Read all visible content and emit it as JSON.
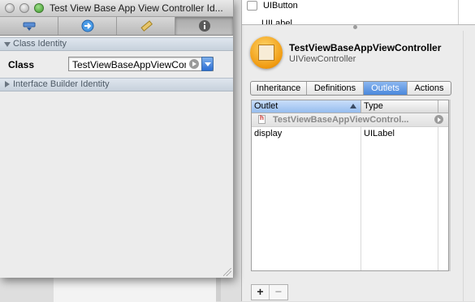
{
  "inspector": {
    "title": "Test View Base App View Controller Id...",
    "tabs": [
      {
        "name": "attributes-tab",
        "icon": "attributes-icon"
      },
      {
        "name": "connections-tab",
        "icon": "connections-arrow-icon"
      },
      {
        "name": "size-tab",
        "icon": "ruler-icon"
      },
      {
        "name": "identity-tab",
        "icon": "info-icon"
      }
    ],
    "active_tab": 3,
    "sections": {
      "class_identity": "Class Identity",
      "ib_identity": "Interface Builder Identity"
    },
    "class_label": "Class",
    "class_value": "TestViewBaseAppViewController"
  },
  "library": {
    "items": [
      {
        "label": "UIButton"
      },
      {
        "label": "UILabel"
      }
    ],
    "object_name": "TestViewBaseAppViewController",
    "object_class": "UIViewController",
    "segments": [
      "Inheritance",
      "Definitions",
      "Outlets",
      "Actions"
    ],
    "active_segment": 2,
    "table": {
      "headers": [
        "Outlet",
        "Type"
      ],
      "group_name": "TestViewBaseAppViewControl...",
      "rows": [
        {
          "outlet": "display",
          "type": "UILabel"
        }
      ]
    },
    "add_label": "+",
    "remove_label": "−"
  },
  "colors": {
    "accent": "#4a87dc",
    "object_icon": "#f09a10"
  }
}
